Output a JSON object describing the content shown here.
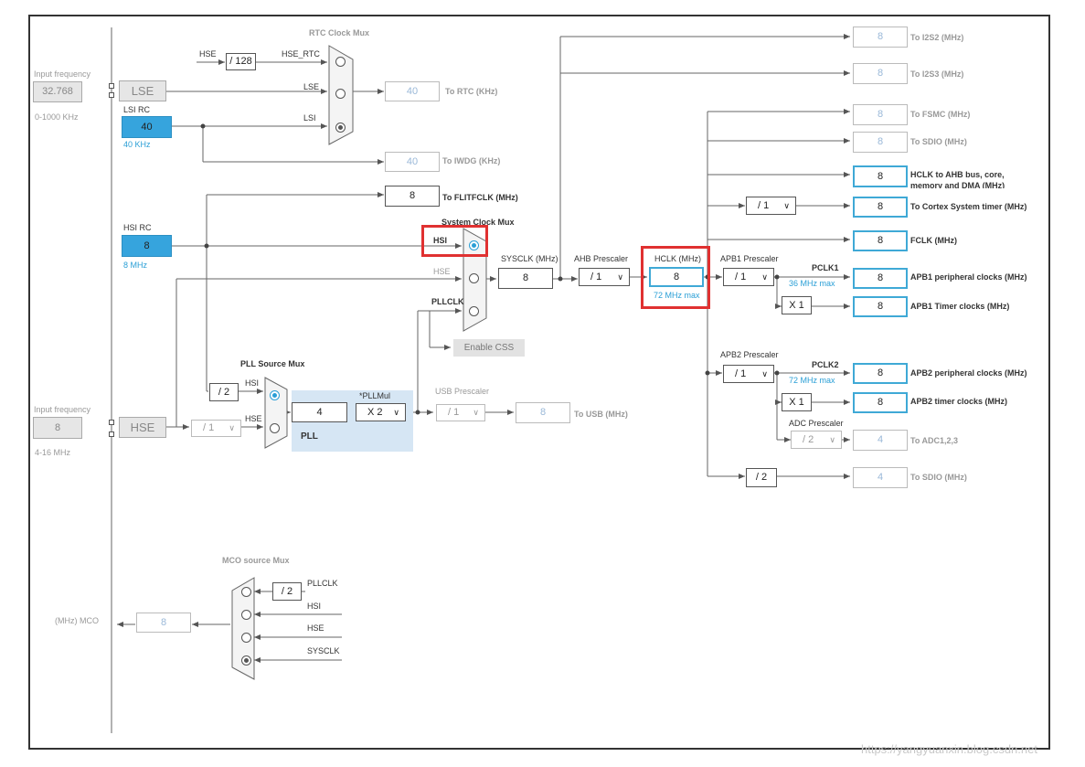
{
  "rtc_mux": {
    "title": "RTC Clock Mux",
    "hse": "HSE",
    "div128": "/ 128",
    "hse_rtc": "HSE_RTC",
    "lse": "LSE",
    "lsi": "LSI",
    "rtc_value": "40",
    "rtc_label": "To RTC (KHz)",
    "iwdg_value": "40",
    "iwdg_label": "To IWDG (KHz)"
  },
  "lse": {
    "input_label": "Input frequency",
    "input_value": "32.768",
    "range": "0-1000 KHz",
    "name": "LSE"
  },
  "lsi": {
    "name": "LSI RC",
    "value": "40",
    "freq": "40 KHz"
  },
  "hsi": {
    "name": "HSI RC",
    "value": "8",
    "freq": "8 MHz"
  },
  "hse": {
    "input_label": "Input frequency",
    "input_value": "8",
    "range": "4-16 MHz",
    "name": "HSE",
    "div": "/ 1"
  },
  "flitf": {
    "value": "8",
    "label": "To FLITFCLK (MHz)"
  },
  "sys_mux": {
    "title": "System Clock Mux",
    "hsi": "HSI",
    "hse": "HSE",
    "pllclk": "PLLCLK",
    "enable_css": "Enable CSS"
  },
  "sysclk": {
    "label": "SYSCLK (MHz)",
    "value": "8"
  },
  "ahb": {
    "label": "AHB Prescaler",
    "value": "/ 1"
  },
  "hclk": {
    "label": "HCLK (MHz)",
    "value": "8",
    "max": "72 MHz max"
  },
  "pll_src": {
    "title": "PLL Source Mux",
    "div2": "/ 2",
    "hsi": "HSI",
    "hse": "HSE"
  },
  "pll": {
    "mul_label": "*PLLMul",
    "input": "4",
    "mul": "X 2",
    "name": "PLL"
  },
  "usb": {
    "label": "USB Prescaler",
    "value": "/ 1",
    "out": "8",
    "out_label": "To USB (MHz)"
  },
  "outputs": {
    "i2s2": {
      "value": "8",
      "label": "To I2S2 (MHz)"
    },
    "i2s3": {
      "value": "8",
      "label": "To I2S3 (MHz)"
    },
    "fsmc": {
      "value": "8",
      "label": "To FSMC (MHz)"
    },
    "sdio": {
      "value": "8",
      "label": "To SDIO (MHz)"
    },
    "hclk_ahb": {
      "value": "8",
      "label": "HCLK to AHB bus, core,",
      "label2": "memory and DMA (MHz)"
    },
    "cortex": {
      "div": "/ 1",
      "value": "8",
      "label": "To Cortex System timer (MHz)"
    },
    "fclk": {
      "value": "8",
      "label": "FCLK (MHz)"
    }
  },
  "apb1": {
    "label": "APB1 Prescaler",
    "value": "/ 1",
    "pclk": "PCLK1",
    "max": "36 MHz max",
    "periph_value": "8",
    "periph_label": "APB1 peripheral clocks (MHz)",
    "timer_mul": "X 1",
    "timer_value": "8",
    "timer_label": "APB1 Timer clocks (MHz)"
  },
  "apb2": {
    "label": "APB2 Prescaler",
    "value": "/ 1",
    "pclk": "PCLK2",
    "max": "72 MHz max",
    "periph_value": "8",
    "periph_label": "APB2 peripheral clocks (MHz)",
    "timer_mul": "X 1",
    "timer_value": "8",
    "timer_label": "APB2 timer clocks (MHz)"
  },
  "adc": {
    "label": "ADC Prescaler",
    "value": "/ 2",
    "out": "4",
    "out_label": "To ADC1,2,3"
  },
  "sdio2": {
    "div": "/ 2",
    "value": "4",
    "label": "To SDIO (MHz)"
  },
  "mco": {
    "title": "MCO source Mux",
    "div2": "/ 2",
    "pllclk": "PLLCLK",
    "hsi": "HSI",
    "hse": "HSE",
    "sysclk": "SYSCLK",
    "label": "(MHz) MCO",
    "value": "8"
  },
  "watermark": "https://yangyuanxin.blog.csdn.net"
}
